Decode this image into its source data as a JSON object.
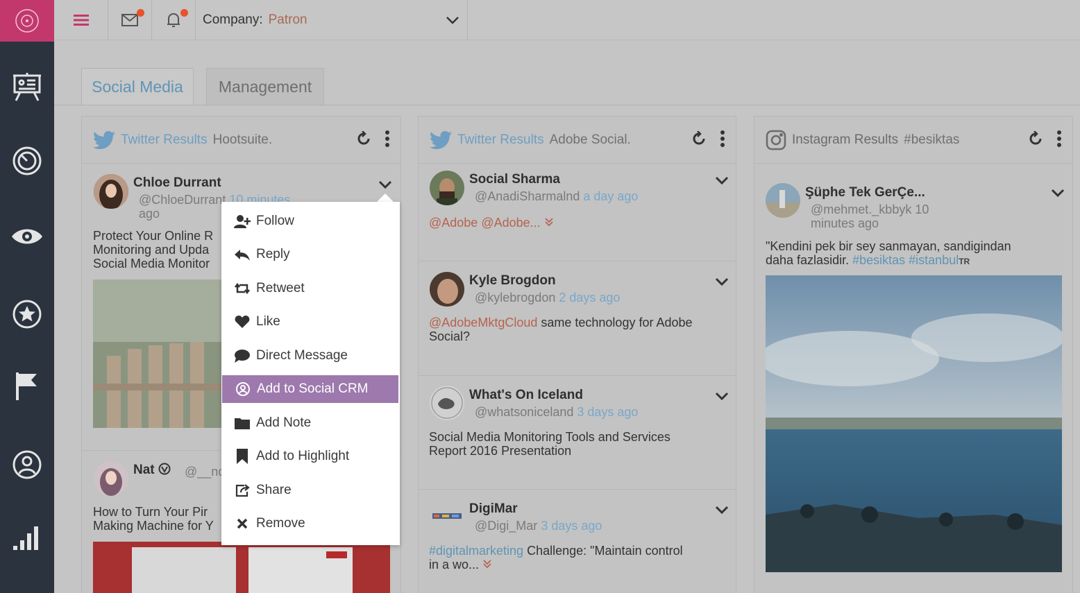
{
  "topbar": {
    "company_label": "Company:",
    "company_value": "Patron"
  },
  "tabs": [
    {
      "label": "Social Media",
      "active": true
    },
    {
      "label": "Management",
      "active": false
    }
  ],
  "columns": [
    {
      "network": "Twitter Results",
      "query": "Hootsuite.",
      "posts": [
        {
          "name": "Chloe Durrant",
          "handle": "@ChloeDurrant",
          "time": "10 minutes",
          "time2": "ago",
          "text_lines": [
            "Protect Your Online R",
            "Monitoring and Upda",
            "Social Media Monitor"
          ]
        },
        {
          "name": "Nat",
          "handle": "@__nc",
          "text_lines": [
            "How to Turn Your Pir",
            "Making Machine for Y"
          ]
        }
      ]
    },
    {
      "network": "Twitter Results",
      "query": "Adobe Social.",
      "posts": [
        {
          "name": "Social Sharma",
          "handle": "@AnadiSharmalnd",
          "time": "a day ago",
          "mentions": "@Adobe @Adobe..."
        },
        {
          "name": "Kyle Brogdon",
          "handle": "@kylebrogdon",
          "time": "2 days ago",
          "mention": "@AdobeMktgCloud",
          "text_rest": "same technology for Adobe",
          "text_line2": "Social?"
        },
        {
          "name": "What's On Iceland",
          "handle": "@whatsoniceland",
          "time": "3 days ago",
          "text_line1": "Social Media Monitoring Tools and Services",
          "text_line2": "Report 2016 Presentation"
        },
        {
          "name": "DigiMar",
          "handle": "@Digi_Mar",
          "time": "3 days ago",
          "hashtag": "#digitalmarketing",
          "text_rest": "Challenge: \"Maintain control",
          "text_line2": "in a wo..."
        }
      ]
    },
    {
      "network": "Instagram Results",
      "query": "#besiktas",
      "posts": [
        {
          "name": "Şüphe Tek GerÇe...",
          "handle": "@mehmet._kbbyk",
          "time": "10",
          "time2": "minutes ago",
          "text_line1": "\"Kendini pek bir sey sanmayan, sandigindan",
          "text_line2_start": "daha fazlasidir.",
          "hashtag1": "#besiktas",
          "hashtag2": "#istanbul",
          "suffix": "TR"
        }
      ]
    }
  ],
  "menu": {
    "items": [
      {
        "label": "Follow",
        "icon": "add-user-icon"
      },
      {
        "label": "Reply",
        "icon": "reply-icon"
      },
      {
        "label": "Retweet",
        "icon": "retweet-icon"
      },
      {
        "label": "Like",
        "icon": "heart-icon"
      },
      {
        "label": "Direct Message",
        "icon": "speech-bubble-icon"
      },
      {
        "label": "Add to Social CRM",
        "icon": "crm-icon",
        "active": true
      },
      {
        "label": "Add Note",
        "icon": "folder-icon"
      },
      {
        "label": "Add to Highlight",
        "icon": "bookmark-icon"
      },
      {
        "label": "Share",
        "icon": "share-icon"
      },
      {
        "label": "Remove",
        "icon": "close-icon"
      }
    ]
  },
  "colors": {
    "brand": "#c2386c",
    "sidebar": "#2a333e",
    "link": "#79a7c9",
    "mention": "#b6634f",
    "menu_active": "#9d79ad"
  }
}
